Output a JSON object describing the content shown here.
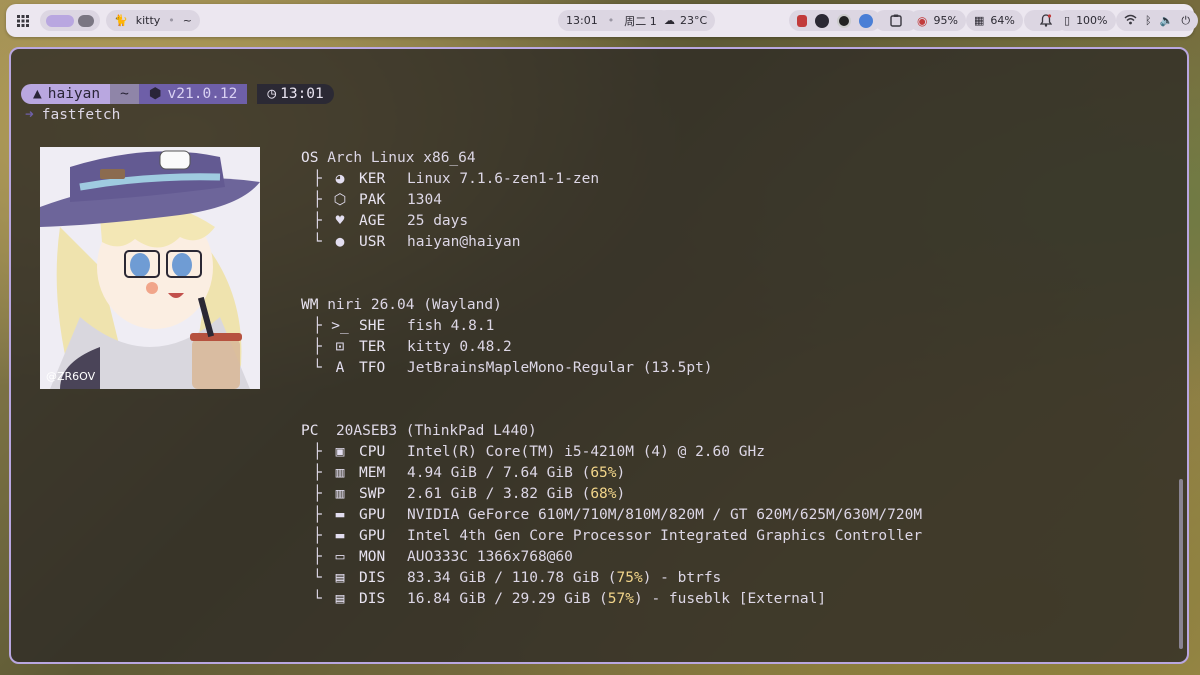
{
  "topbar": {
    "window_title": "kitty",
    "window_dir": "~",
    "time": "13:01",
    "date": "周二 11",
    "weather": "23°C",
    "cpu": "95%",
    "memory": "64%",
    "battery": "100%"
  },
  "prompt": {
    "user": "haiyan",
    "dir": "~",
    "version": "v21.0.12",
    "time": "13:01",
    "command": "fastfetch"
  },
  "avatar": {
    "watermark": "@ZR6OV"
  },
  "fetch": {
    "os": {
      "label": "OS",
      "value": "Arch Linux x86_64"
    },
    "ker": {
      "label": "KER",
      "value": "Linux 7.1.6-zen1-1-zen"
    },
    "pak": {
      "label": "PAK",
      "value": "1304"
    },
    "age": {
      "label": "AGE",
      "value": "25 days"
    },
    "usr": {
      "label": "USR",
      "value": "haiyan@haiyan"
    },
    "wm": {
      "label": "WM",
      "value": "niri 26.04 (Wayland)"
    },
    "she": {
      "label": "SHE",
      "value": "fish 4.8.1"
    },
    "ter": {
      "label": "TER",
      "value": "kitty 0.48.2"
    },
    "tfo": {
      "label": "TFO",
      "value": "JetBrainsMapleMono-Regular (13.5pt)"
    },
    "pc": {
      "label": "PC",
      "value": "20ASEB3 (ThinkPad L440)"
    },
    "cpu": {
      "label": "CPU",
      "value": "Intel(R) Core(TM) i5-4210M (4) @ 2.60 GHz"
    },
    "mem": {
      "label": "MEM",
      "value": "4.94 GiB / 7.64 GiB (",
      "pct": "65%",
      "tail": ")"
    },
    "swp": {
      "label": "SWP",
      "value": "2.61 GiB / 3.82 GiB (",
      "pct": "68%",
      "tail": ")"
    },
    "gpu1": {
      "label": "GPU",
      "value": "NVIDIA GeForce 610M/710M/810M/820M / GT 620M/625M/630M/720M"
    },
    "gpu2": {
      "label": "GPU",
      "value": "Intel 4th Gen Core Processor Integrated Graphics Controller"
    },
    "mon": {
      "label": "MON",
      "value": "AUO333C 1366x768@60"
    },
    "dis1": {
      "label": "DIS",
      "value": "83.34 GiB / 110.78 GiB (",
      "pct": "75%",
      "tail": ") - btrfs"
    },
    "dis2": {
      "label": "DIS",
      "value": "16.84 GiB / 29.29 GiB (",
      "pct": "57%",
      "tail": ") - fuseblk [External]"
    }
  },
  "colors": {
    "accent": "#b9a7e0",
    "highlight": "#f2d58a",
    "terminal_bg": "#302c26"
  },
  "icons": [
    "apps-grid-icon",
    "kitty-icon",
    "weather-icon",
    "notes-icon",
    "cpu-icon",
    "memory-icon",
    "bell-icon",
    "battery-icon",
    "wifi-icon",
    "bluetooth-icon",
    "volume-icon",
    "power-icon"
  ]
}
